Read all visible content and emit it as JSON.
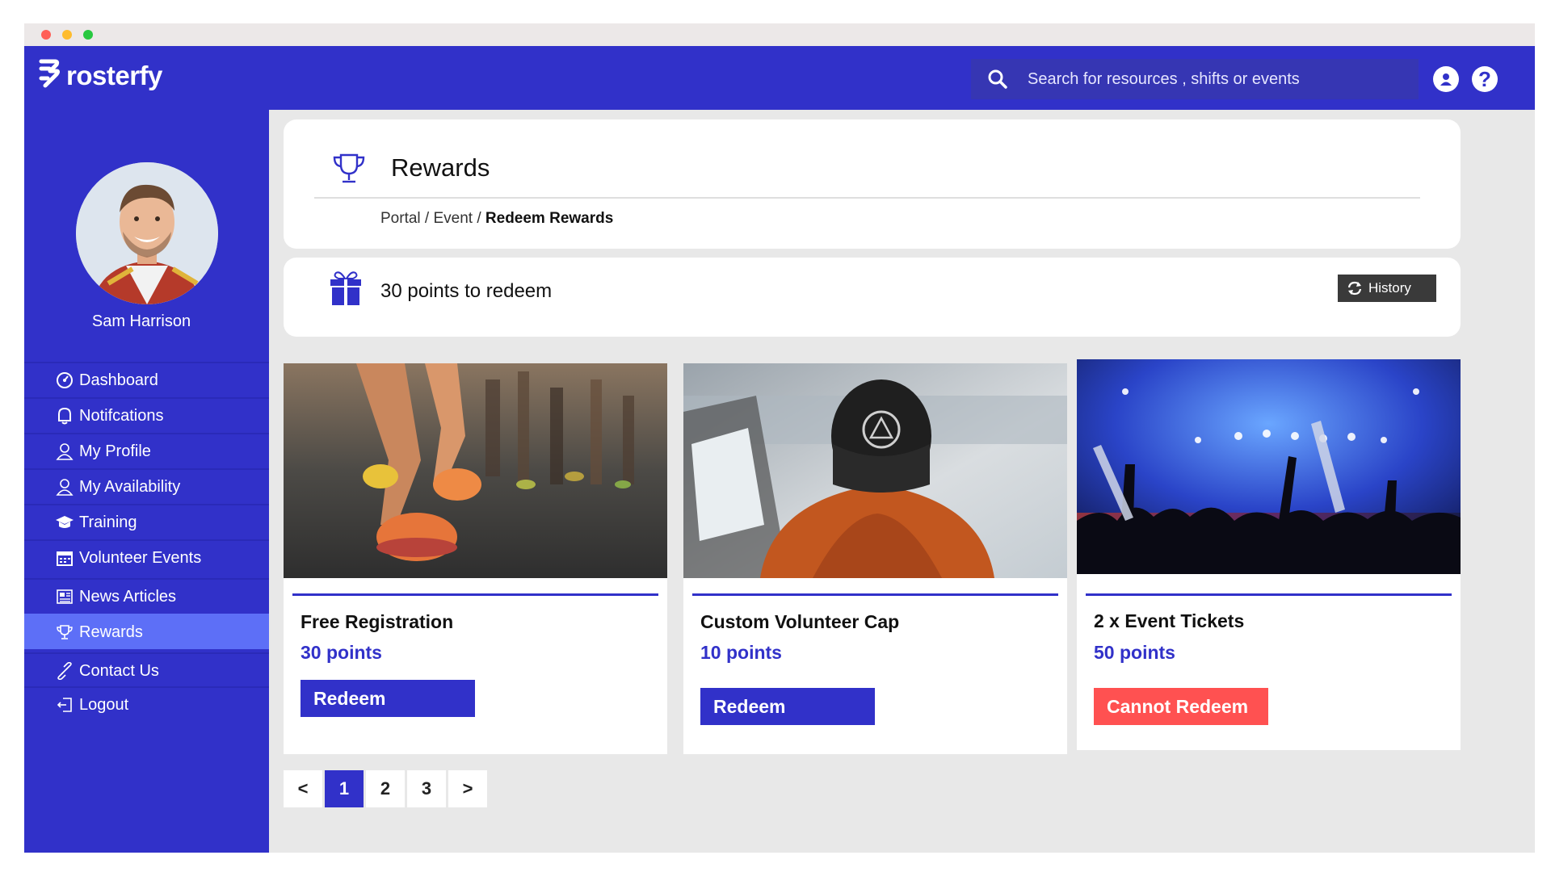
{
  "brand": {
    "name": "rosterfy",
    "color": "#3131c9"
  },
  "header": {
    "search_placeholder": "Search for resources , shifts or events",
    "help_glyph": "?"
  },
  "user": {
    "name": "Sam Harrison"
  },
  "sidebar": {
    "items": [
      {
        "label": "Dashboard",
        "icon": "dashboard-icon"
      },
      {
        "label": "Notifcations",
        "icon": "bell-icon"
      },
      {
        "label": "My Profile",
        "icon": "user-icon"
      },
      {
        "label": "My Availability",
        "icon": "user-icon"
      },
      {
        "label": "Training",
        "icon": "graduation-cap-icon"
      },
      {
        "label": "Volunteer Events",
        "icon": "calendar-icon"
      },
      {
        "label": "News Articles",
        "icon": "newspaper-icon"
      },
      {
        "label": "Rewards",
        "icon": "trophy-icon",
        "active": true
      },
      {
        "label": "Contact Us",
        "icon": "link-icon"
      },
      {
        "label": "Logout",
        "icon": "logout-icon"
      }
    ]
  },
  "page": {
    "title": "Rewards",
    "breadcrumb": {
      "part1": "Portal / ",
      "part2": "Event / ",
      "current": "Redeem Rewards"
    }
  },
  "points": {
    "text": "30 points to redeem",
    "history_label": "History"
  },
  "rewards": [
    {
      "name": "Free Registration",
      "points": "30 points",
      "button": "Redeem",
      "status": "redeemable",
      "image": "runners-legs-photo"
    },
    {
      "name": "Custom Volunteer Cap",
      "points": "10 points",
      "button": "Redeem",
      "status": "redeemable",
      "image": "person-in-cap-photo"
    },
    {
      "name": "2 x Event Tickets",
      "points": "50 points",
      "button": "Cannot Redeem",
      "status": "unavailable",
      "image": "concert-crowd-photo"
    }
  ],
  "pagination": {
    "prev": "<",
    "pages": [
      "1",
      "2",
      "3"
    ],
    "next": ">",
    "current": "1"
  },
  "colors": {
    "accent": "#3131c9",
    "active_nav": "#5d6ff7",
    "cannot_redeem": "#ff5151",
    "history_button": "#3a3a3a"
  }
}
